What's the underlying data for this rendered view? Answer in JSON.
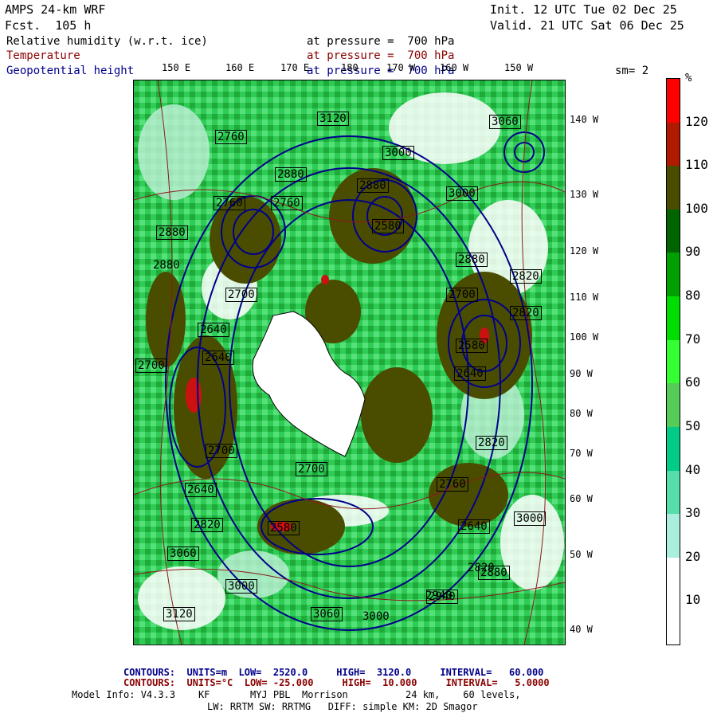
{
  "header": {
    "model": "AMPS 24-km WRF",
    "forecast": "Fcst.  105 h",
    "init": "Init. 12 UTC Tue 02 Dec 25",
    "valid": "Valid. 21 UTC Sat 06 Dec 25"
  },
  "fields": [
    {
      "name": "Relative humidity (w.r.t. ice)",
      "level": "at pressure =  700 hPa",
      "color": "#000000"
    },
    {
      "name": "Temperature",
      "level": "at pressure =  700 hPa",
      "color": "#8b0000"
    },
    {
      "name": "Geopotential height",
      "level": "at pressure =  700 hPa",
      "color": "#00008b"
    }
  ],
  "smoothing": "sm= 2",
  "longitude_labels_top": [
    "150 E",
    "160 E",
    "170 E",
    "180",
    "170 W",
    "160 W",
    "150 W"
  ],
  "longitude_labels_right": [
    "140 W",
    "130 W",
    "120 W",
    "110 W",
    "100 W",
    "90 W",
    "80 W",
    "70 W",
    "60 W",
    "50 W",
    "40 W"
  ],
  "height_labels": [
    "3120",
    "2820",
    "3060",
    "2940",
    "3000",
    "2880",
    "2760",
    "2880",
    "2880",
    "2640",
    "2820",
    "2700",
    "2640",
    "2640",
    "2580",
    "2700",
    "2760",
    "2640",
    "2580",
    "2700",
    "2820",
    "2880",
    "2760",
    "2700",
    "2580",
    "2820",
    "2820",
    "2640",
    "2700",
    "2880",
    "2760",
    "3000",
    "2880",
    "2940",
    "3000",
    "3060",
    "3120",
    "3000",
    "3000",
    "3060"
  ],
  "colorbar": {
    "unit": "%",
    "ticks": [
      "120",
      "110",
      "100",
      "90",
      "80",
      "70",
      "60",
      "50",
      "40",
      "30",
      "20",
      "10"
    ],
    "colors": [
      "#ff0000",
      "#b01a00",
      "#4a4d00",
      "#006400",
      "#00a000",
      "#00dd00",
      "#33ff33",
      "#55cc55",
      "#00cc88",
      "#55ddaa",
      "#aaeedd",
      "#ffffff",
      "#ffffff"
    ],
    "brand_colors": {
      "green": "#22cc44",
      "dark_olive": "#4a4d00",
      "red": "#cc1111"
    }
  },
  "footer": {
    "line1_label": "CONTOURS:  UNITS=m  LOW=  2520.0     HIGH=  3120.0     INTERVAL=   60.000",
    "line2_label": "CONTOURS:  UNITS=°C  LOW= -25.000     HIGH=  10.000     INTERVAL=   5.0000",
    "line3": "Model Info: V4.3.3    KF       MYJ PBL  Morrison          24 km,    60 levels,",
    "line4": "LW: RRTM SW: RRTMG   DIFF: simple KM: 2D Smagor"
  }
}
